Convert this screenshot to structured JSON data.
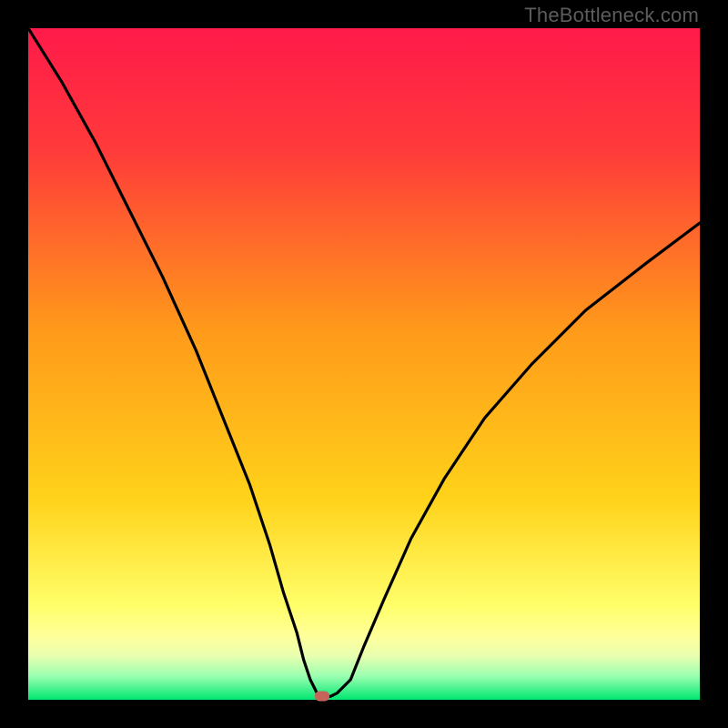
{
  "watermark": "TheBottleneck.com",
  "colors": {
    "gradient_top": "#ff1a4a",
    "gradient_mid": "#ffb200",
    "gradient_yellow_band": "#ffff9a",
    "gradient_bottom": "#00e770",
    "curve": "#000000",
    "marker": "#c6645b",
    "frame_bg": "#000000",
    "watermark": "#5c5c5c"
  },
  "chart_data": {
    "type": "line",
    "title": "",
    "xlabel": "",
    "ylabel": "",
    "xlim": [
      0,
      100
    ],
    "ylim": [
      0,
      100
    ],
    "legend": false,
    "grid": false,
    "yellow_band_y_range": [
      7,
      14
    ],
    "series": [
      {
        "name": "bottleneck-curve",
        "x": [
          0,
          5,
          10,
          15,
          20,
          25,
          29,
          33,
          36,
          38,
          40,
          41,
          42,
          43,
          43.5,
          44,
          45,
          46,
          48,
          50,
          53,
          57,
          62,
          68,
          75,
          83,
          92,
          100
        ],
        "values": [
          100,
          92,
          83,
          73,
          63,
          52,
          42,
          32,
          23,
          16,
          10,
          6,
          3,
          1,
          0.5,
          0.5,
          0.5,
          1,
          3,
          8,
          15,
          24,
          33,
          42,
          50,
          58,
          65,
          71
        ]
      }
    ],
    "marker_point": {
      "x": 43.8,
      "y": 0.5
    },
    "gradient_stops": [
      {
        "offset": 0.0,
        "color": "#ff1a4a"
      },
      {
        "offset": 0.18,
        "color": "#ff3a3a"
      },
      {
        "offset": 0.45,
        "color": "#ff9a1a"
      },
      {
        "offset": 0.7,
        "color": "#ffd21a"
      },
      {
        "offset": 0.86,
        "color": "#ffff6a"
      },
      {
        "offset": 0.905,
        "color": "#ffff9a"
      },
      {
        "offset": 0.935,
        "color": "#e8ffb0"
      },
      {
        "offset": 0.965,
        "color": "#9affb0"
      },
      {
        "offset": 1.0,
        "color": "#00e770"
      }
    ]
  }
}
